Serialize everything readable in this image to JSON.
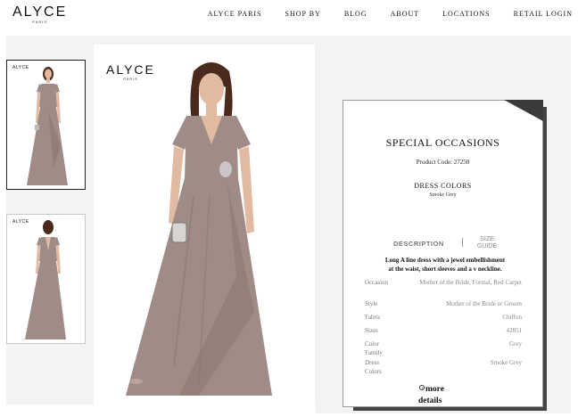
{
  "brand": {
    "name": "ALYCE",
    "sub": "PARIS"
  },
  "nav": [
    {
      "label": "ALYCE PARIS"
    },
    {
      "label": "SHOP BY"
    },
    {
      "label": "BLOG"
    },
    {
      "label": "ABOUT"
    },
    {
      "label": "LOCATIONS"
    },
    {
      "label": "RETAIL LOGIN"
    }
  ],
  "gallery": {
    "thumb_logo": "ALYCE",
    "main_logo": "ALYCE",
    "main_logo_sub": "PARIS"
  },
  "product": {
    "title": "SPECIAL OCCASIONS",
    "code": "Product Code: 27250",
    "colors_heading": "DRESS COLORS",
    "colors_value": "Smoke Grey",
    "tab_description": "DESCRIPTION",
    "tab_size_guide_1": "SIZE",
    "tab_size_guide_2": "GUIDE",
    "description_1": "Long A line dress with a jewel embellishment",
    "description_2": "at the waist, short sleeves and a v neckline.",
    "specs": [
      {
        "label": "Occasion",
        "value": "Mother of the Bride, Formal, Red Carpet"
      },
      {
        "label": "Style",
        "value": "Mother of the Bride or Groom"
      },
      {
        "label": "Fabric",
        "value": "Chiffon"
      },
      {
        "label": "Sizes",
        "value": "42851"
      },
      {
        "label": "Color Family",
        "value": "Grey"
      },
      {
        "label": "Dress Colors",
        "value": "Smoke Grey"
      }
    ],
    "more_1": "more",
    "more_2": "details"
  },
  "colors": {
    "dress": "#a08c86",
    "dress_dark": "#8a7670",
    "hair": "#4a2a1c",
    "skin": "#e2b9a1",
    "corner": "#3a3a3a"
  }
}
